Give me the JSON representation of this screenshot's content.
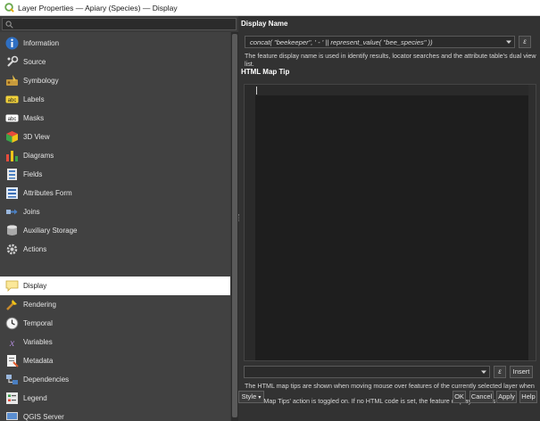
{
  "window": {
    "title": "Layer Properties — Apiary (Species) — Display"
  },
  "nav": {
    "items": [
      {
        "label": "Information",
        "icon": "information-icon"
      },
      {
        "label": "Source",
        "icon": "source-icon"
      },
      {
        "label": "Symbology",
        "icon": "symbology-icon"
      },
      {
        "label": "Labels",
        "icon": "labels-icon"
      },
      {
        "label": "Masks",
        "icon": "masks-icon"
      },
      {
        "label": "3D View",
        "icon": "3d-view-icon"
      },
      {
        "label": "Diagrams",
        "icon": "diagrams-icon"
      },
      {
        "label": "Fields",
        "icon": "fields-icon"
      },
      {
        "label": "Attributes Form",
        "icon": "attributes-form-icon"
      },
      {
        "label": "Joins",
        "icon": "joins-icon"
      },
      {
        "label": "Auxiliary Storage",
        "icon": "auxiliary-storage-icon"
      },
      {
        "label": "Actions",
        "icon": "actions-icon"
      },
      {
        "label": "Display",
        "icon": "display-icon"
      },
      {
        "label": "Rendering",
        "icon": "rendering-icon"
      },
      {
        "label": "Temporal",
        "icon": "temporal-icon"
      },
      {
        "label": "Variables",
        "icon": "variables-icon"
      },
      {
        "label": "Metadata",
        "icon": "metadata-icon"
      },
      {
        "label": "Dependencies",
        "icon": "dependencies-icon"
      },
      {
        "label": "Legend",
        "icon": "legend-icon"
      },
      {
        "label": "QGIS Server",
        "icon": "qgis-server-icon"
      }
    ],
    "selected": "Display"
  },
  "display": {
    "display_name_title": "Display Name",
    "expression": "concat( \"beekeeper\", ' - ' || represent_value( \"bee_species\" ))",
    "expression_button": "ε",
    "display_name_help": "The feature display name is used in identify results, locator searches and the attribute table's dual view list.",
    "map_tip_title": "HTML Map Tip",
    "insert_expression_button": "ε",
    "insert_button": "Insert",
    "map_tip_help_1": "The HTML map tips are shown when moving mouse over features of the currently selected layer when the",
    "map_tip_help_2": "'Show Map Tips' action is toggled on. If no HTML code is set, the feature display name is used."
  },
  "footer": {
    "style_label": "Style",
    "ok_label": "OK",
    "cancel_label": "Cancel",
    "apply_label": "Apply",
    "help_label": "Help"
  },
  "colors": {
    "selected_row": "#ffffff",
    "panel": "#414141",
    "background": "#323232",
    "editor": "#1e1e1e"
  }
}
